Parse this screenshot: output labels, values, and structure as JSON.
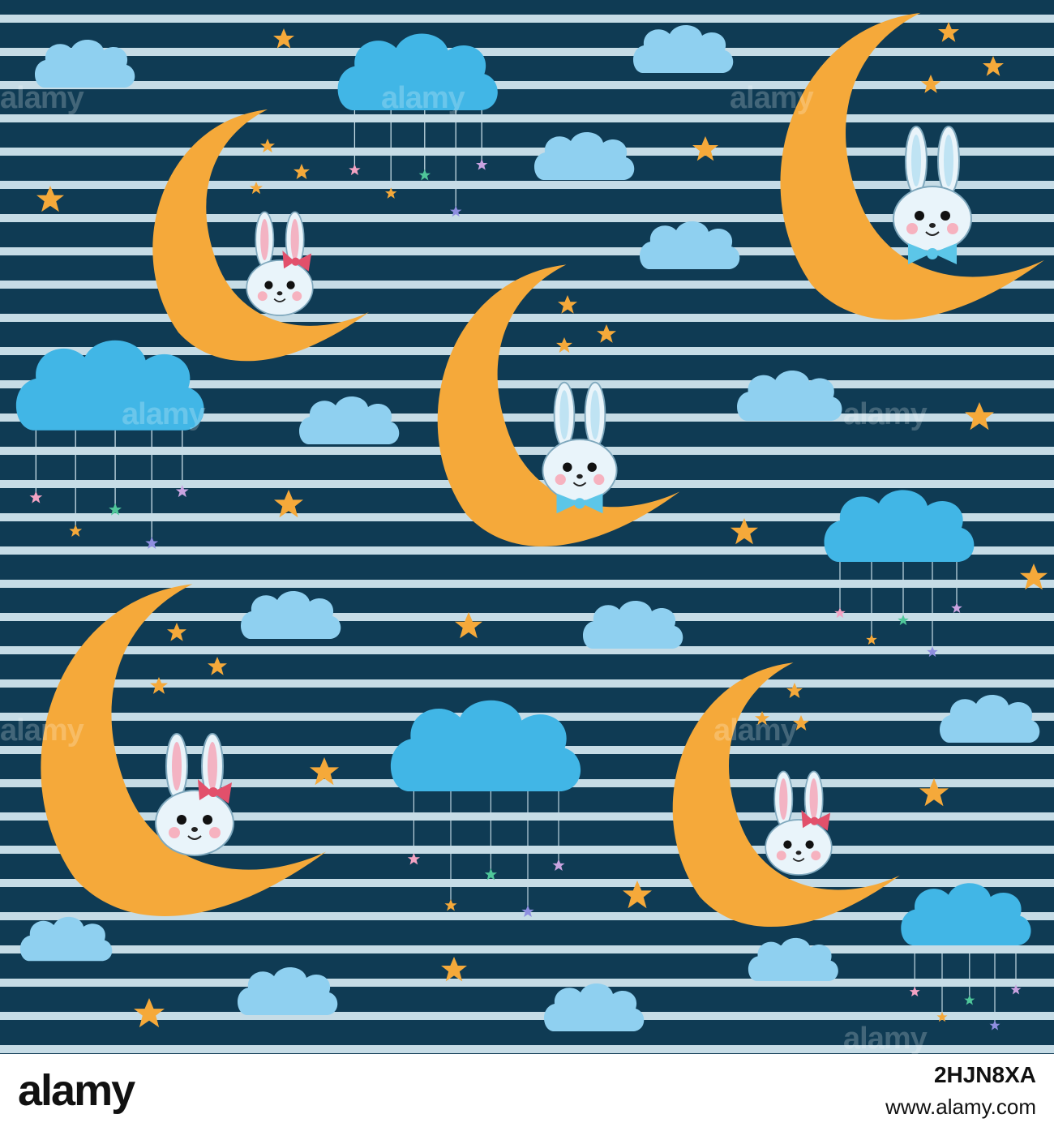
{
  "colors": {
    "background": "#0f3b54",
    "stripe": "#c6dce6",
    "moon": "#f5a93a",
    "cloud": "#41b6e6",
    "cloud_light": "#8fd0f0",
    "star": "#f5a93a",
    "bunny": "#e9f4fa"
  },
  "watermark": {
    "text": "alamy"
  },
  "footer": {
    "logo": "alamy",
    "image_id": "2HJN8XA",
    "url": "www.alamy.com"
  }
}
